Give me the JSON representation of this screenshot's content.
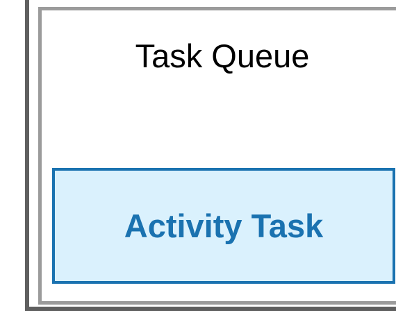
{
  "task_queue": {
    "title": "Task Queue",
    "frame_color": "#5f5f5f",
    "inner_frame_color": "#9b9b9b"
  },
  "activity_task": {
    "label": "Activity Task",
    "fill_color": "#daf1fd",
    "border_color": "#1a72b0"
  }
}
